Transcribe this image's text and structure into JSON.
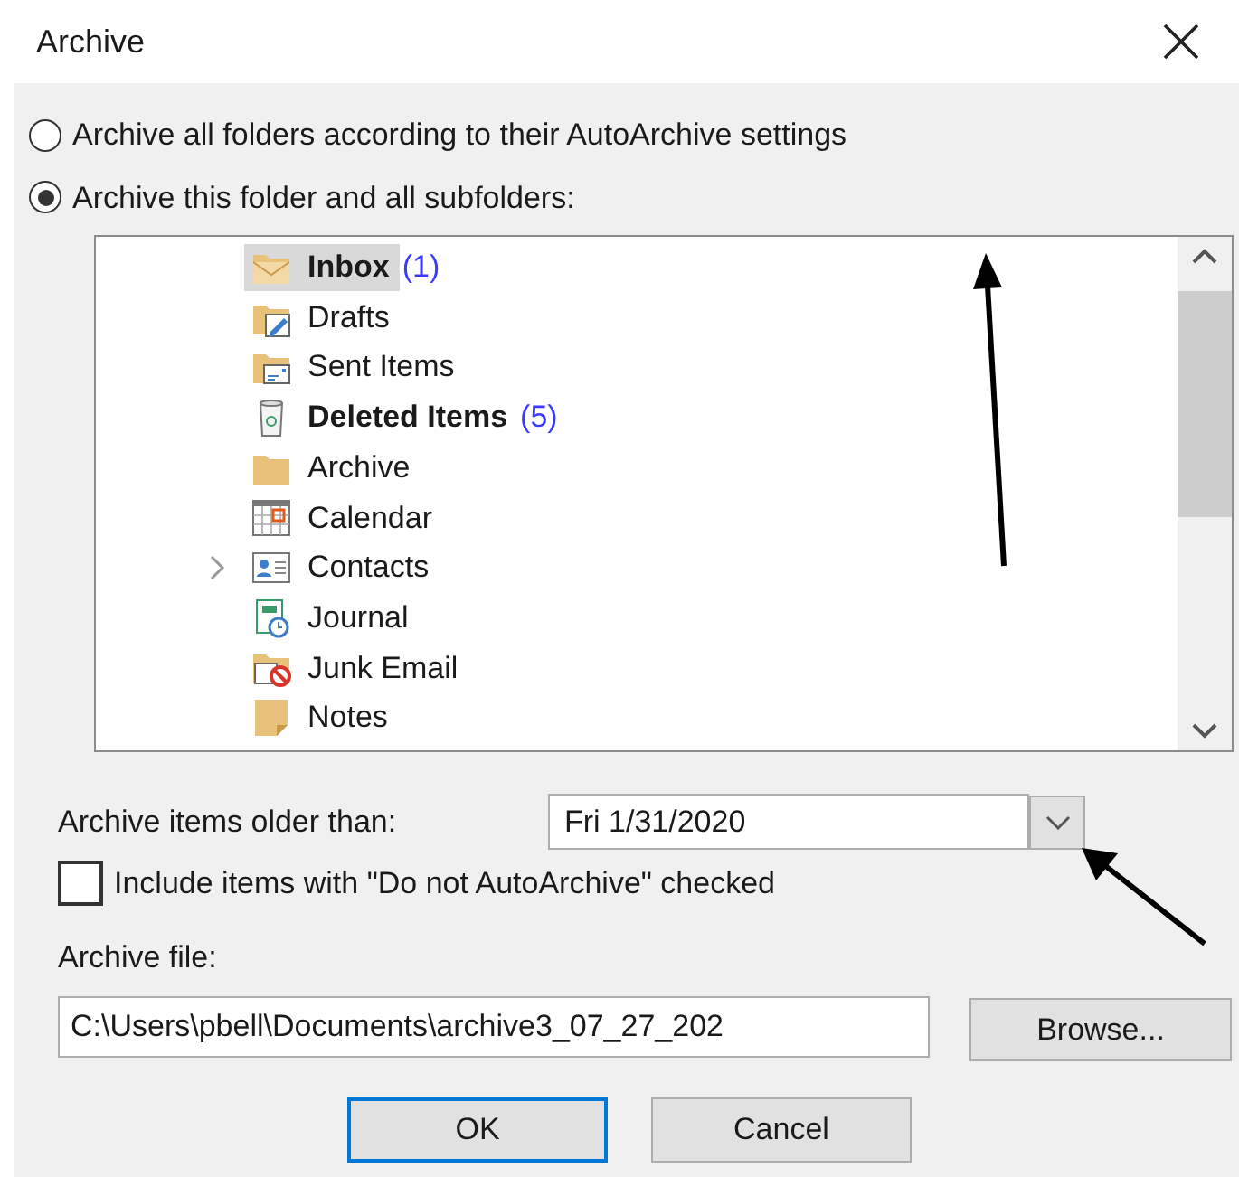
{
  "window": {
    "title": "Archive"
  },
  "scope_options": [
    {
      "label": "Archive all folders according to their AutoArchive settings",
      "selected": false
    },
    {
      "label": "Archive this folder and all subfolders:",
      "selected": true
    }
  ],
  "folders": [
    {
      "name": "Inbox",
      "kind": "inbox",
      "unread": true,
      "count": "(1)",
      "selected": true,
      "expandable": false
    },
    {
      "name": "Drafts",
      "kind": "drafts",
      "unread": false,
      "selected": false,
      "expandable": false
    },
    {
      "name": "Sent Items",
      "kind": "sent",
      "unread": false,
      "selected": false,
      "expandable": false
    },
    {
      "name": "Deleted Items",
      "kind": "trash",
      "unread": true,
      "count": "(5)",
      "selected": false,
      "expandable": false
    },
    {
      "name": "Archive",
      "kind": "folder",
      "unread": false,
      "selected": false,
      "expandable": false
    },
    {
      "name": "Calendar",
      "kind": "calendar",
      "unread": false,
      "selected": false,
      "expandable": false
    },
    {
      "name": "Contacts",
      "kind": "contacts",
      "unread": false,
      "selected": false,
      "expandable": true
    },
    {
      "name": "Journal",
      "kind": "journal",
      "unread": false,
      "selected": false,
      "expandable": false
    },
    {
      "name": "Junk Email",
      "kind": "junk",
      "unread": false,
      "selected": false,
      "expandable": false
    },
    {
      "name": "Notes",
      "kind": "notes",
      "unread": false,
      "selected": false,
      "expandable": false
    }
  ],
  "older_than": {
    "label": "Archive items older than:",
    "value": "Fri 1/31/2020"
  },
  "include_option": {
    "label": "Include items with \"Do not AutoArchive\" checked",
    "checked": false
  },
  "archive_file": {
    "label": "Archive file:",
    "value": "C:\\Users\\pbell\\Documents\\archive3_07_27_202",
    "browse": "Browse..."
  },
  "buttons": [
    {
      "label": "OK",
      "default": true
    },
    {
      "label": "Cancel",
      "default": false
    }
  ]
}
